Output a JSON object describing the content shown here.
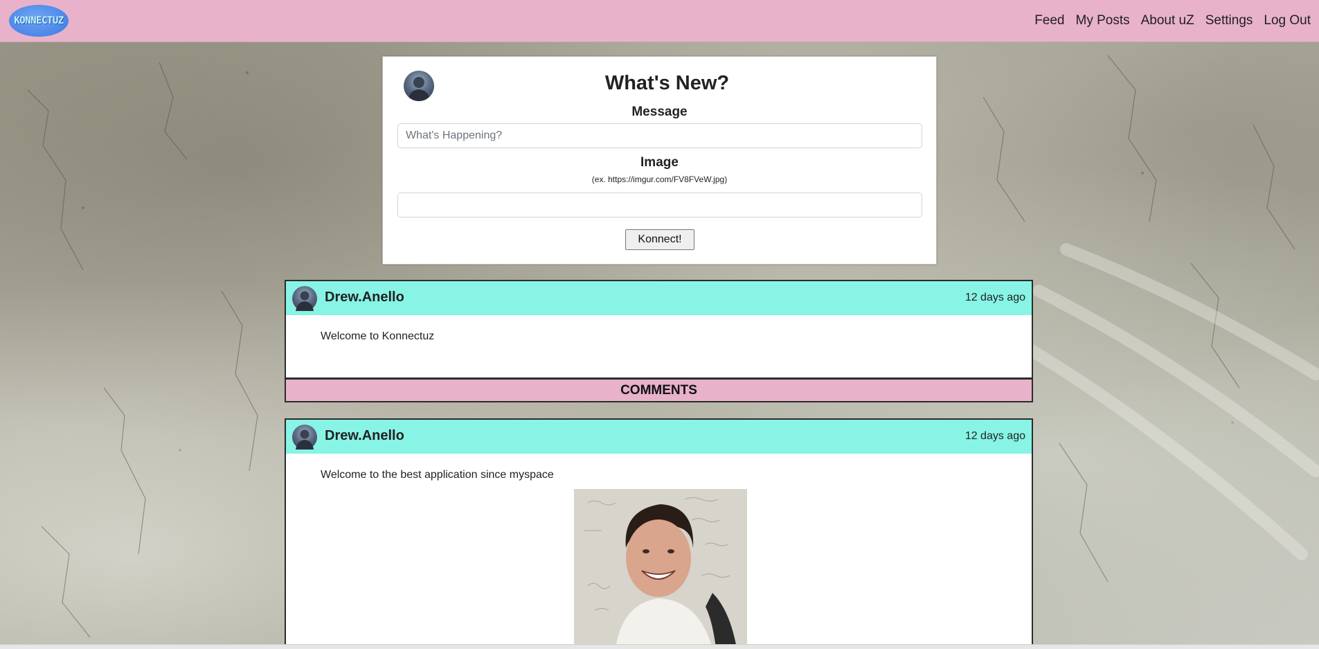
{
  "brand": {
    "logo_text": "KONNECTUZ"
  },
  "nav": {
    "items": [
      "Feed",
      "My Posts",
      "About uZ",
      "Settings",
      "Log Out"
    ]
  },
  "new_post": {
    "title": "What's New?",
    "message_label": "Message",
    "message_placeholder": "What's Happening?",
    "image_label": "Image",
    "image_hint": "(ex. https://imgur.com/FV8FVeW.jpg)",
    "submit_label": "Konnect!"
  },
  "posts": [
    {
      "author": "Drew.Anello",
      "time": "12 days ago",
      "text": "Welcome to Konnectuz",
      "comments_label": "COMMENTS"
    },
    {
      "author": "Drew.Anello",
      "time": "12 days ago",
      "text": "Welcome to the best application since myspace",
      "has_image": true
    }
  ],
  "colors": {
    "navbar": "#e8b2cb",
    "post_header": "#88f4e5",
    "comments_bar": "#e8b2cb",
    "logo": "#4a86e8"
  }
}
